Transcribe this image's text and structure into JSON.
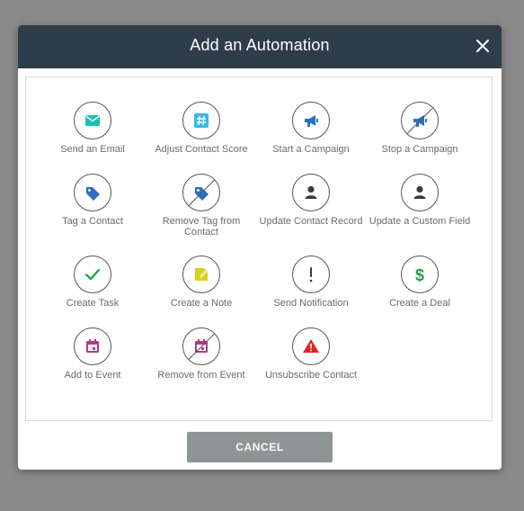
{
  "dialog": {
    "title": "Add an Automation",
    "close_icon": "close-icon",
    "cancel_label": "CANCEL"
  },
  "actions": [
    {
      "label": "Send an Email",
      "icon": "envelope-icon",
      "color": "#1fbfb0"
    },
    {
      "label": "Adjust Contact Score",
      "icon": "hashtag-icon",
      "color": "#35b9e6"
    },
    {
      "label": "Start a Campaign",
      "icon": "megaphone-icon",
      "color": "#2a6fc4"
    },
    {
      "label": "Stop a Campaign",
      "icon": "megaphone-off-icon",
      "color": "#2a6fc4"
    },
    {
      "label": "Tag a Contact",
      "icon": "tag-icon",
      "color": "#2a6fc4"
    },
    {
      "label": "Remove Tag from Contact",
      "icon": "tag-off-icon",
      "color": "#2a6fc4"
    },
    {
      "label": "Update Contact Record",
      "icon": "person-icon",
      "color": "#2f3d4b"
    },
    {
      "label": "Update a Custom Field",
      "icon": "person-icon",
      "color": "#2f3d4b"
    },
    {
      "label": "Create Task",
      "icon": "checkmark-icon",
      "color": "#21a04b"
    },
    {
      "label": "Create a Note",
      "icon": "note-pencil-icon",
      "color": "#d6d020"
    },
    {
      "label": "Send Notification",
      "icon": "exclamation-icon",
      "color": "#2f3d4b"
    },
    {
      "label": "Create a Deal",
      "icon": "dollar-icon",
      "color": "#21a04b"
    },
    {
      "label": "Add to Event",
      "icon": "calendar-icon",
      "color": "#b13a84"
    },
    {
      "label": "Remove from Event",
      "icon": "calendar-off-icon",
      "color": "#b13a84"
    },
    {
      "label": "Unsubscribe Contact",
      "icon": "warning-icon",
      "color": "#e02424"
    }
  ]
}
